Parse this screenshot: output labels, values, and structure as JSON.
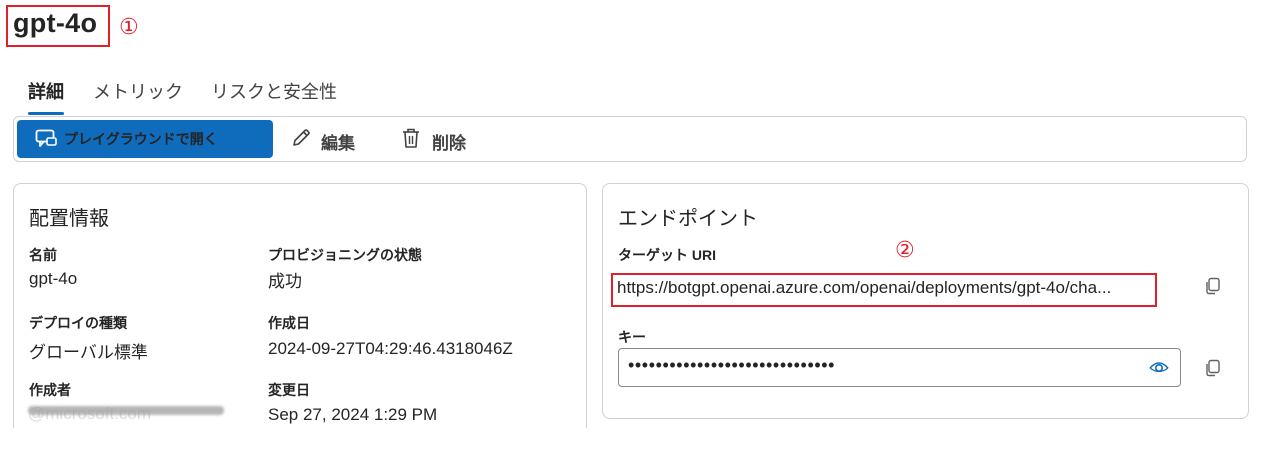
{
  "header": {
    "title": "gpt-4o",
    "annotation_1": "①"
  },
  "tabs": [
    {
      "label": "詳細"
    },
    {
      "label": "メトリック"
    },
    {
      "label": "リスクと安全性"
    }
  ],
  "toolbar": {
    "open_playground_label": "プレイグラウンドで開く",
    "edit_label": "編集",
    "delete_label": "削除"
  },
  "deployment_info": {
    "title": "配置情報",
    "name_label": "名前",
    "name_value": "gpt-4o",
    "provisioning_label": "プロビジョニングの状態",
    "provisioning_value": "成功",
    "deploy_type_label": "デプロイの種類",
    "deploy_type_value": "グローバル標準",
    "created_at_label": "作成日",
    "created_at_value": "2024-09-27T04:29:46.4318046Z",
    "created_by_label": "作成者",
    "created_by_value": "@microsoft.com",
    "modified_label": "変更日",
    "modified_value": "Sep 27, 2024 1:29 PM"
  },
  "endpoint": {
    "title": "エンドポイント",
    "target_uri_label": "ターゲット URI",
    "annotation_2": "②",
    "target_uri_value": "https://botgpt.openai.azure.com/openai/deployments/gpt-4o/cha...",
    "key_label": "キー",
    "key_value": "••••••••••••••••••••••••••••••"
  },
  "colors": {
    "accent": "#0f6cbd",
    "annotation": "#e0202a",
    "border": "#d1d1d1"
  },
  "icons": [
    "chat-open-icon",
    "pencil-icon",
    "trash-icon",
    "copy-icon",
    "eye-icon"
  ]
}
